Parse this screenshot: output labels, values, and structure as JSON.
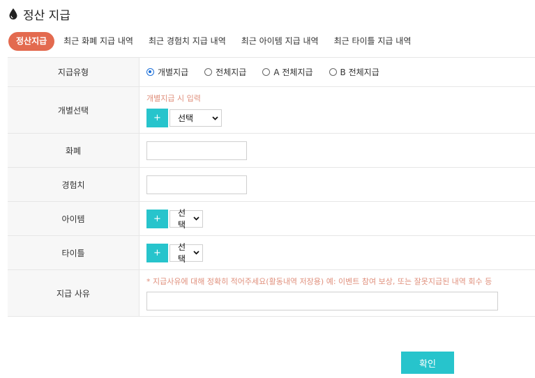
{
  "page": {
    "title": "정산 지급"
  },
  "tabs": [
    {
      "label": "정산지급",
      "active": true
    },
    {
      "label": "최근 화폐 지급 내역",
      "active": false
    },
    {
      "label": "최근 경험치 지급 내역",
      "active": false
    },
    {
      "label": "최근 아이템 지급 내역",
      "active": false
    },
    {
      "label": "최근 타이틀 지급 내역",
      "active": false
    }
  ],
  "form": {
    "type": {
      "label": "지급유형",
      "options": [
        {
          "label": "개별지급",
          "selected": true
        },
        {
          "label": "전체지급",
          "selected": false
        },
        {
          "label": "A 전체지급",
          "selected": false
        },
        {
          "label": "B 전체지급",
          "selected": false
        }
      ]
    },
    "individual": {
      "label": "개별선택",
      "hint": "개별지급 시 입력",
      "add": "+",
      "select": "선택"
    },
    "currency": {
      "label": "화폐",
      "value": ""
    },
    "exp": {
      "label": "경험치",
      "value": ""
    },
    "item": {
      "label": "아이템",
      "add": "+",
      "select": "선택"
    },
    "titleRow": {
      "label": "타이틀",
      "add": "+",
      "select": "선택"
    },
    "reason": {
      "label": "지급 사유",
      "hint": "* 지급사유에 대해 정확히 적어주세요(활동내역 저장용) 예: 이벤트 참여 보상, 또는 잘못지급된 내역 회수 등",
      "value": ""
    }
  },
  "buttons": {
    "confirm": "확인"
  },
  "colors": {
    "accent": "#27c4cc",
    "activeTab": "#e36a4f",
    "hint": "#e0907d",
    "radio": "#1a6ed8"
  },
  "icons": {
    "title": "water-drop-icon",
    "select": "chevron-down-icon"
  }
}
